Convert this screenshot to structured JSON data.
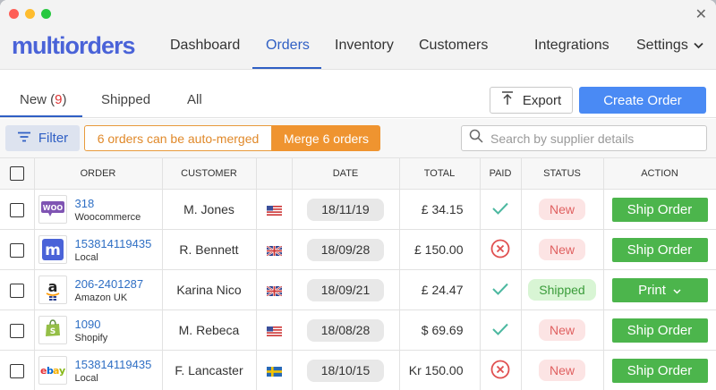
{
  "app": {
    "logo": "multiorders"
  },
  "nav": {
    "items": [
      "Dashboard",
      "Orders",
      "Inventory",
      "Customers",
      "Integrations",
      "Settings"
    ],
    "active": "Orders"
  },
  "subtabs": {
    "new_label": "New (",
    "new_count": "9",
    "new_close": ")",
    "shipped": "Shipped",
    "all": "All"
  },
  "actions": {
    "export": "Export",
    "create_order": "Create Order"
  },
  "toolbar": {
    "filter": "Filter",
    "merge_message": "6 orders can be auto-merged",
    "merge_button": "Merge 6 orders",
    "search_placeholder": "Search by supplier details"
  },
  "table": {
    "headers": [
      "ORDER",
      "CUSTOMER",
      "DATE",
      "TOTAL",
      "PAID",
      "STATUS",
      "ACTION"
    ],
    "rows": [
      {
        "id": "318",
        "source": "Woocommerce",
        "customer": "M. Jones",
        "country": "US",
        "date": "18/11/19",
        "total": "£ 34.15",
        "paid": true,
        "status": "New",
        "action": "Ship Order",
        "logo": "woocommerce-logo-icon"
      },
      {
        "id": "153814119435",
        "source": "Local",
        "customer": "R. Bennett",
        "country": "UK",
        "date": "18/09/28",
        "total": "£ 150.00",
        "paid": false,
        "status": "New",
        "action": "Ship Order",
        "logo": "multiorders-logo-icon"
      },
      {
        "id": "206-2401287",
        "source": "Amazon UK",
        "customer": "Karina Nico",
        "country": "UK",
        "date": "18/09/21",
        "total": "£ 24.47",
        "paid": true,
        "status": "Shipped",
        "action": "Print",
        "logo": "amazon-logo-icon"
      },
      {
        "id": "1090",
        "source": "Shopify",
        "customer": "M. Rebeca",
        "country": "US",
        "date": "18/08/28",
        "total": "$ 69.69",
        "paid": true,
        "status": "New",
        "action": "Ship Order",
        "logo": "shopify-logo-icon"
      },
      {
        "id": "153814119435",
        "source": "Local",
        "customer": "F. Lancaster",
        "country": "SE",
        "date": "18/10/15",
        "total": "Kr 150.00",
        "paid": false,
        "status": "New",
        "action": "Ship Order",
        "logo": "ebay-logo-icon"
      }
    ]
  },
  "colors": {
    "accent": "#4a8af4",
    "brand": "#4a63d8",
    "success": "#4cb54c",
    "warning": "#ef9430",
    "danger": "#e06060"
  }
}
